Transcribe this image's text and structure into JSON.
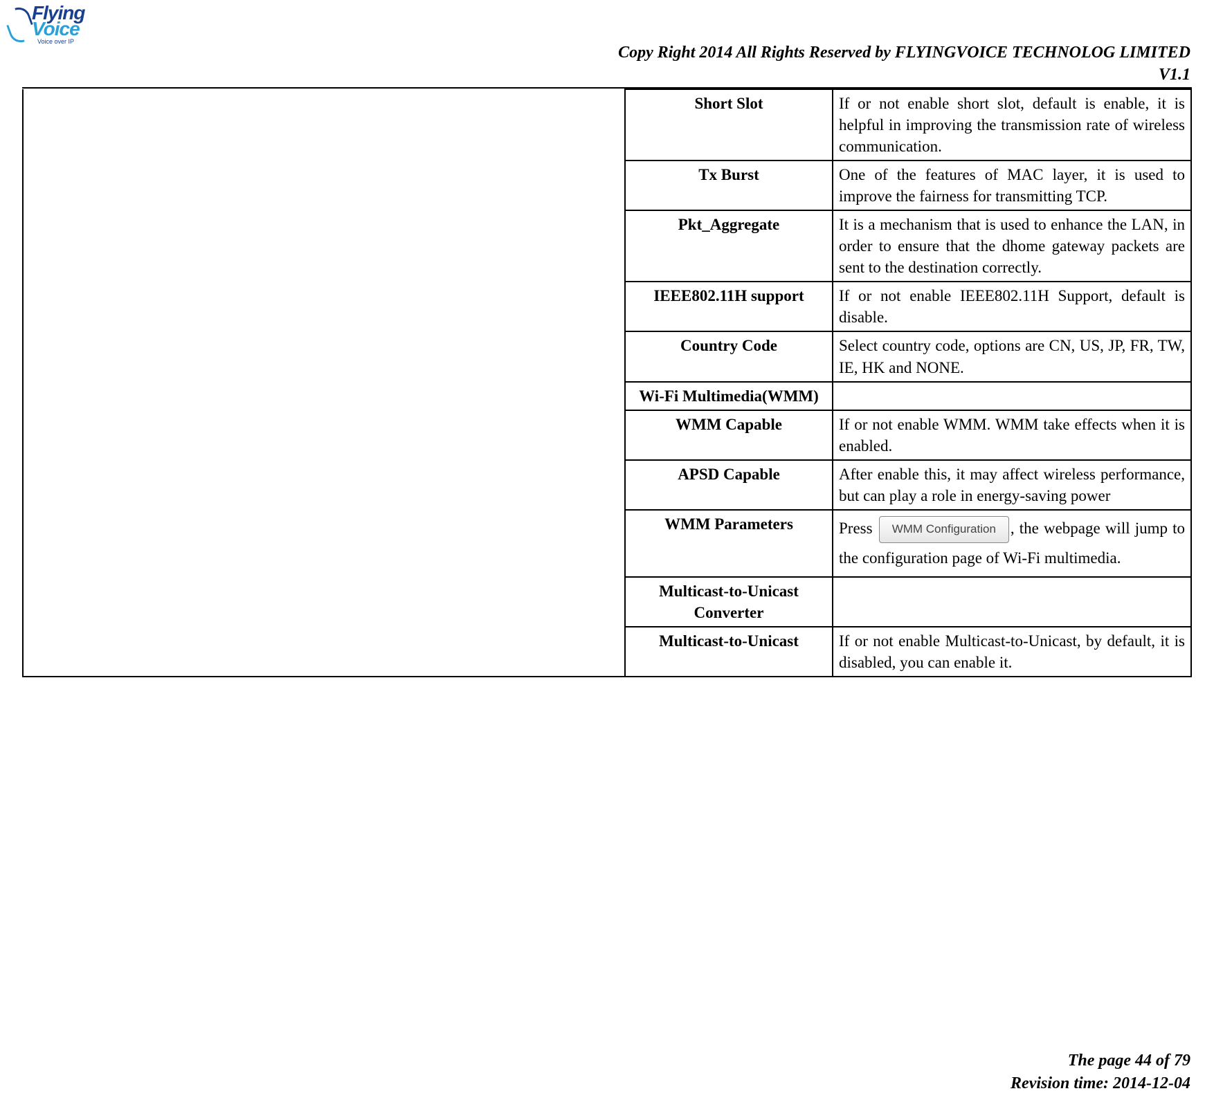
{
  "logo": {
    "line1": "Flying",
    "line2": "Voice",
    "tagline": "Voice over IP"
  },
  "header": {
    "copyright": "Copy Right 2014 All Rights Reserved by FLYINGVOICE TECHNOLOG LIMITED",
    "version": "V1.1"
  },
  "rows": [
    {
      "name": "Short Slot",
      "desc": "If or not enable short slot, default is enable, it is helpful in improving the transmission rate of wireless communication."
    },
    {
      "name": "Tx Burst",
      "desc": "One of the features of MAC layer, it is used to improve the fairness for transmitting TCP."
    },
    {
      "name": "Pkt_Aggregate",
      "desc": "It is a mechanism that is used to enhance the LAN, in order to ensure that the dhome gateway packets are sent to the destination correctly."
    },
    {
      "name": "IEEE802.11H support",
      "desc": "If or not enable IEEE802.11H Support, default is disable."
    },
    {
      "name": "Country Code",
      "desc": "Select country code, options are CN, US, JP, FR, TW, IE, HK and NONE."
    },
    {
      "name": "Wi-Fi Multimedia(WMM)",
      "desc": ""
    },
    {
      "name": "WMM Capable",
      "desc": "If or not enable WMM. WMM take effects when it is enabled."
    },
    {
      "name": "APSD Capable",
      "desc": "After enable this, it may affect wireless performance, but can play a role in energy-saving power"
    },
    {
      "name": "WMM Parameters",
      "desc_pre": "Press",
      "button_label": "WMM Configuration",
      "desc_post": ", the webpage will jump to the configuration page of Wi-Fi multimedia."
    },
    {
      "name": "Multicast-to-Unicast Converter",
      "desc": ""
    },
    {
      "name": "Multicast-to-Unicast",
      "desc": "If or not enable Multicast-to-Unicast, by default, it is disabled, you can enable it."
    }
  ],
  "footer": {
    "page": "The page 44 of 79",
    "revision": "Revision time: 2014-12-04"
  }
}
